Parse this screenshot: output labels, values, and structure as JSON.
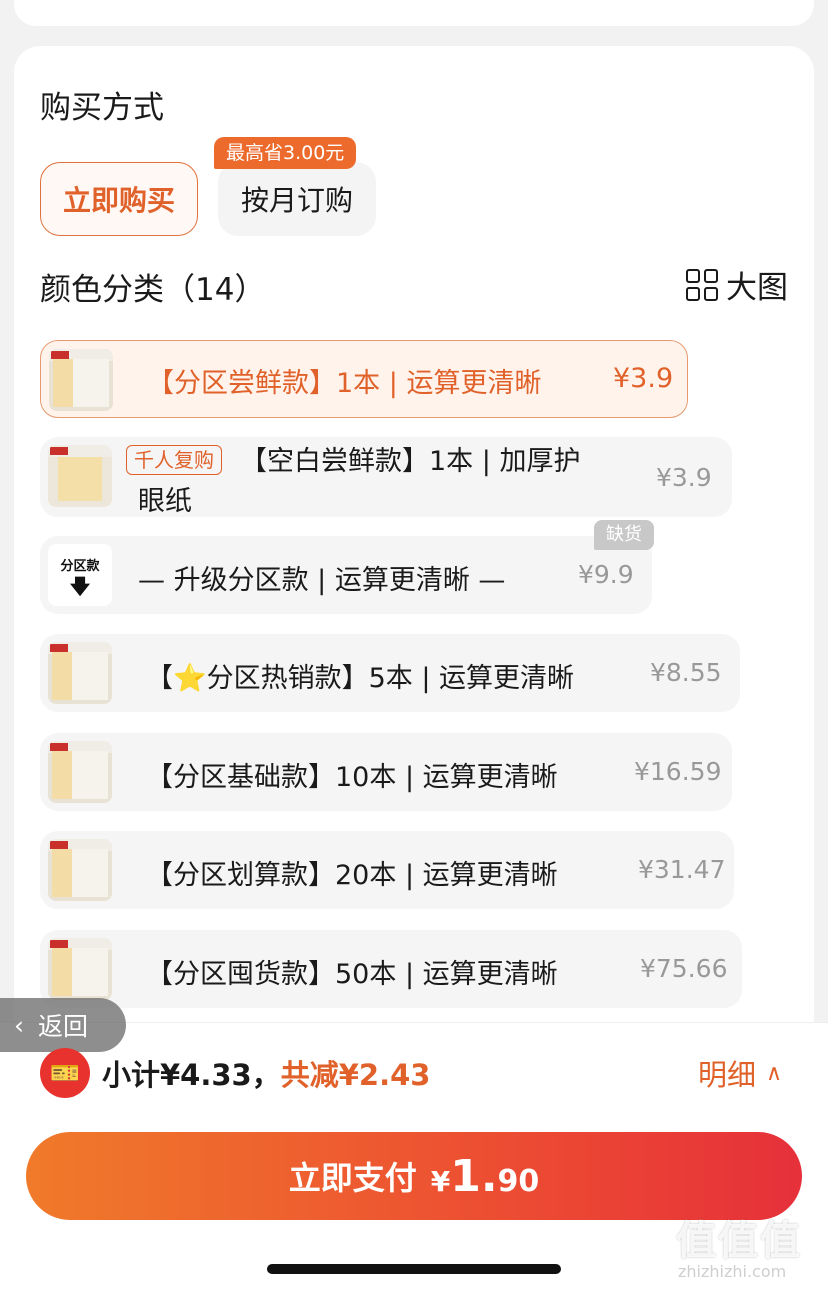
{
  "purchase": {
    "title": "购买方式",
    "buy_now_label": "立即购买",
    "monthly_label": "按月订购",
    "save_badge": "最高省3.00元"
  },
  "colors": {
    "title": "颜色分类（14）",
    "bigview_label": "大图",
    "options": [
      {
        "label": "【分区尝鲜款】1本 | 运算更清晰",
        "price": "¥3.9",
        "selected": true
      },
      {
        "tag": "千人复购",
        "label": "【空白尝鲜款】1本 | 加厚护",
        "label_line2": "眼纸",
        "price": "¥3.9"
      },
      {
        "thumb_text": "分区款",
        "label": "— 升级分区款 | 运算更清晰 —",
        "price": "¥9.9",
        "status": "缺货"
      },
      {
        "label": "【⭐分区热销款】5本 | 运算更清晰",
        "price": "¥8.55"
      },
      {
        "label": "【分区基础款】10本 | 运算更清晰",
        "price": "¥16.59"
      },
      {
        "label": "【分区划算款】20本 | 运算更清晰",
        "price": "¥31.47"
      },
      {
        "label": "【分区囤货款】50本 | 运算更清晰",
        "price": "¥75.66"
      }
    ]
  },
  "nav": {
    "back_label": "返回"
  },
  "summary": {
    "subtotal": "小计¥4.33，",
    "discount": "共减¥2.43",
    "detail_label": "明细"
  },
  "pay": {
    "label": "立即支付",
    "currency": "¥",
    "integer": "1.",
    "decimals": "90"
  },
  "watermark": {
    "text": "值值值",
    "url": "zhizhizhi.com"
  },
  "theme": {
    "accent": "#e0622a",
    "pay_gradient_start": "#f07a2a",
    "pay_gradient_end": "#e6303a"
  }
}
